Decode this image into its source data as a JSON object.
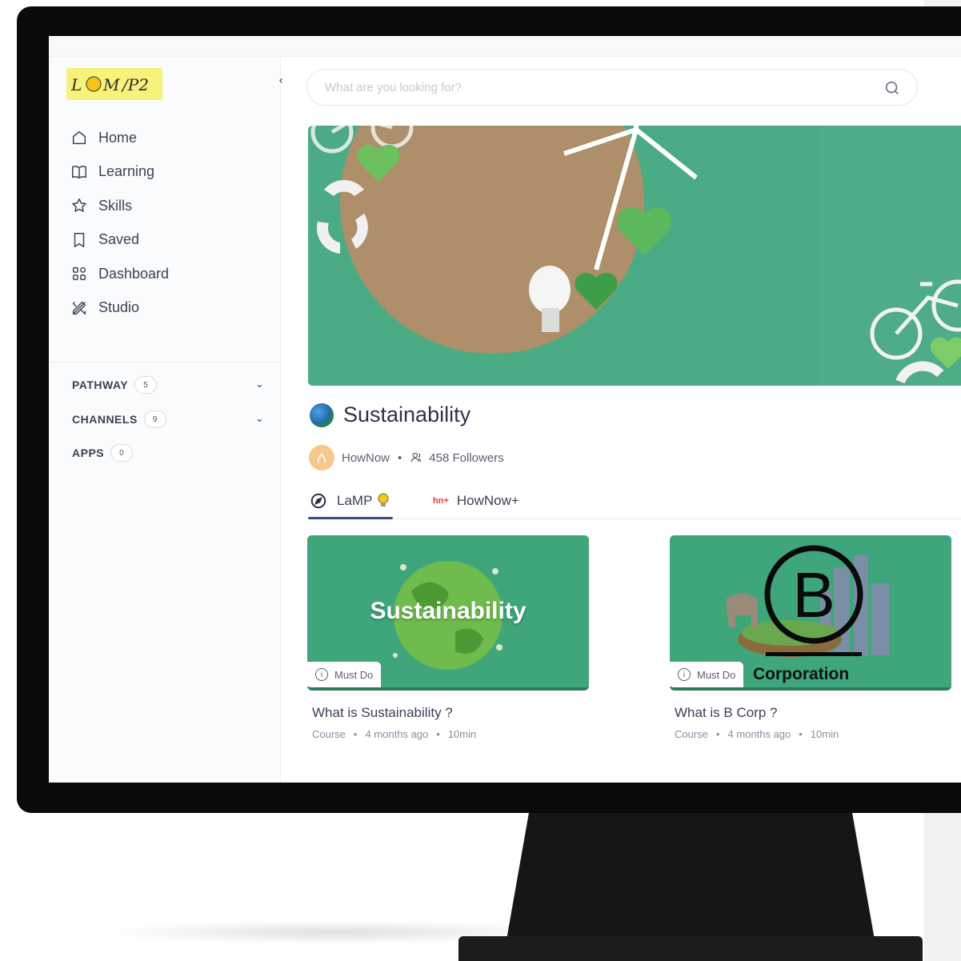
{
  "sidebar": {
    "logo_text": "L💡M P2",
    "collapse_icon": "chevron-left-icon",
    "nav": [
      {
        "label": "Home",
        "icon": "home-icon"
      },
      {
        "label": "Learning",
        "icon": "book-icon"
      },
      {
        "label": "Skills",
        "icon": "star-icon"
      },
      {
        "label": "Saved",
        "icon": "bookmark-icon"
      },
      {
        "label": "Dashboard",
        "icon": "grid-icon"
      },
      {
        "label": "Studio",
        "icon": "pencil-ruler-icon"
      }
    ],
    "sections": [
      {
        "label": "PATHWAY",
        "count": "5"
      },
      {
        "label": "CHANNELS",
        "count": "9"
      },
      {
        "label": "APPS",
        "count": "0"
      }
    ]
  },
  "search": {
    "placeholder": "What are you looking for?"
  },
  "channel": {
    "title": "Sustainability",
    "owner": "HowNow",
    "followers": "458 Followers"
  },
  "tabs": [
    {
      "label": "LaMP",
      "active": true
    },
    {
      "badge": "hn+",
      "label": "HowNow+"
    }
  ],
  "cards": [
    {
      "overlay_text": "Sustainability",
      "badge": "Must Do",
      "title": "What is Sustainability ?",
      "type": "Course",
      "age": "4 months ago",
      "duration": "10min"
    },
    {
      "overlay_text": "Corporation",
      "badge": "Must Do",
      "title": "What is B Corp ?",
      "type": "Course",
      "age": "4 months ago",
      "duration": "10min"
    }
  ],
  "colors": {
    "accent_green": "#4aab84",
    "active_tab": "#3a4a8a",
    "text": "#3b4256"
  }
}
